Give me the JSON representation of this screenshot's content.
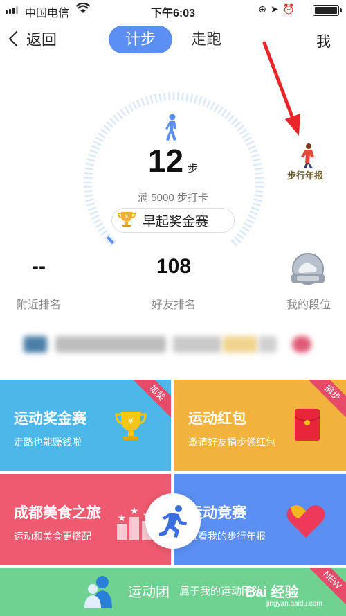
{
  "status_bar": {
    "carrier": "中国电信",
    "time": "下午6:03"
  },
  "nav": {
    "back_label": "返回",
    "tabs": [
      {
        "label": "计步",
        "active": true
      },
      {
        "label": "走跑",
        "active": false
      }
    ],
    "me_label": "我"
  },
  "pedometer": {
    "steps": "12",
    "steps_unit": "步",
    "goal_text": "满 5000 步打卡",
    "goal_progress": 0.0024,
    "early_bird_label": "早起奖金赛"
  },
  "annual_report": {
    "label": "步行年报"
  },
  "stats": [
    {
      "value": "--",
      "label": "附近排名"
    },
    {
      "value": "108",
      "label": "好友排名"
    },
    {
      "value": "",
      "label": "我的段位"
    }
  ],
  "tiles": {
    "contest": {
      "title": "运动奖金赛",
      "sub": "走路也能赚钱啦",
      "ribbon": "加奖"
    },
    "redpack": {
      "title": "运动红包",
      "sub": "邀请好友捐步领红包",
      "ribbon": "捐步"
    },
    "food": {
      "title": "成都美食之旅",
      "sub": "运动和美食更搭配"
    },
    "compete": {
      "title": "运动竞赛",
      "sub": "查看我的步行年报"
    },
    "team": {
      "title": "运动团",
      "sub": "属于我的运动团队",
      "ribbon": "NEW"
    }
  },
  "colors": {
    "accent_blue": "#5b8ff3",
    "tile_contest": "#4db7ea",
    "tile_redpack": "#f2b23e",
    "tile_food": "#ee5a6f",
    "tile_compete": "#5b8ff3",
    "tile_team": "#6fd290",
    "arrow_red": "#e8262a"
  },
  "watermark": {
    "brand": "Bai 经验",
    "url": "jingyan.baidu.com"
  }
}
